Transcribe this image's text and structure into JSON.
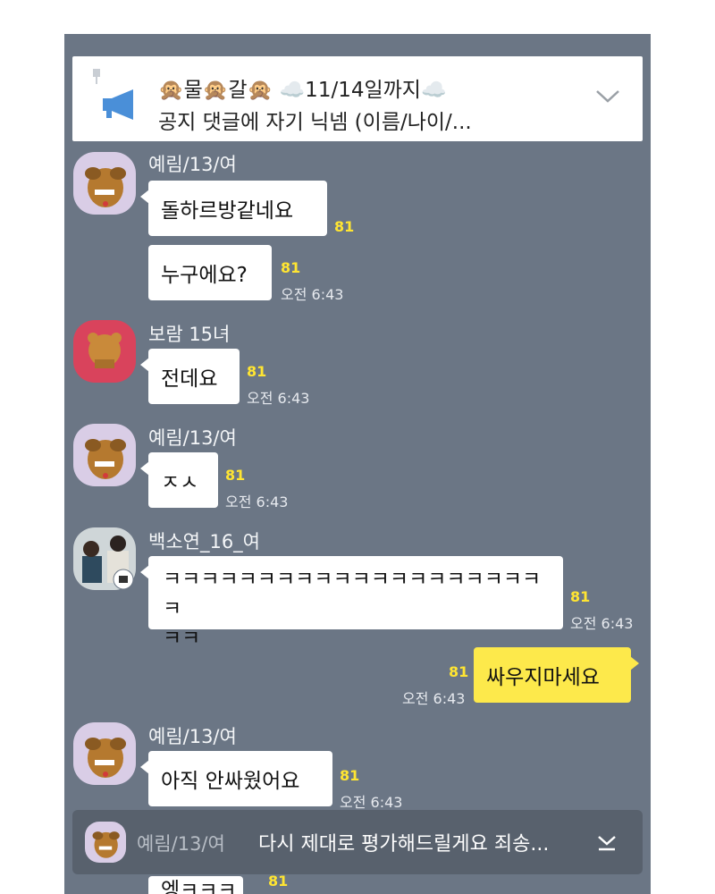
{
  "notice": {
    "title": "🙊물🙊갈🙊 ☁️11/14일까지☁️",
    "body": "공지 댓글에 자기 닉넴 (이름/나이/..."
  },
  "messages": [
    {
      "sender": "예림/13/여",
      "text": "돌하르방같네요",
      "unread": "81",
      "time": ""
    },
    {
      "sender": "",
      "text": "누구에요?",
      "unread": "81",
      "time": "오전 6:43"
    },
    {
      "sender": "보람 15녀",
      "text": "전데요",
      "unread": "81",
      "time": "오전 6:43"
    },
    {
      "sender": "예림/13/여",
      "text": "ㅈㅅ",
      "unread": "81",
      "time": "오전 6:43"
    },
    {
      "sender": "백소연_16_여",
      "text": "ㅋㅋㅋㅋㅋㅋㅋㅋㅋㅋㅋㅋㅋㅋㅋㅋㅋㅋㅋㅋㅋ",
      "text2": "ㅋㅋ",
      "unread": "81",
      "time": "오전 6:43"
    },
    {
      "sender": "",
      "text": "싸우지마세요",
      "unread": "81",
      "time": "오전 6:43",
      "mine": true
    },
    {
      "sender": "예림/13/여",
      "text": "아직 안싸웠어요",
      "unread": "81",
      "time": "오전 6:43"
    }
  ],
  "preview": {
    "sender": "예림/13/여",
    "text": "다시 제대로 평가해드릴게요 죄송..."
  },
  "partial": {
    "text": "엥ㅋㅋㅋ",
    "unread": "81"
  },
  "colors": {
    "background": "#6b7685",
    "my_bubble": "#fde94b",
    "unread": "#ffe532"
  },
  "icons": [
    "pin-icon",
    "megaphone-icon",
    "chevron-down-icon",
    "scroll-down-icon"
  ]
}
